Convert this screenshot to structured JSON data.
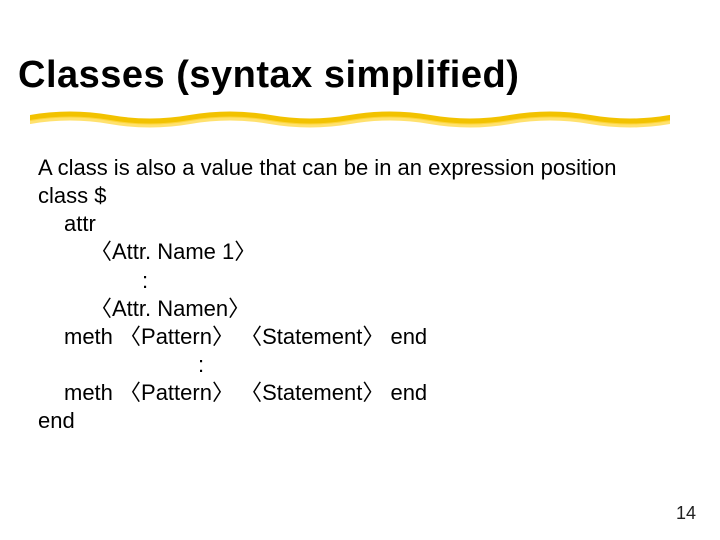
{
  "title": "Classes (syntax simplified)",
  "intro": "A class is also a value that can be in an expression position",
  "lines": {
    "class_decl": "class $",
    "attr_kw": "attr",
    "attr1": "〈Attr. Name 1〉",
    "vdots1": ":",
    "attrn": "〈Attr. Namen〉",
    "meth1": "meth 〈Pattern〉  〈Statement〉  end",
    "vdots2": ":",
    "meth2": "meth 〈Pattern〉  〈Statement〉  end",
    "end": "end"
  },
  "page_number": "14"
}
